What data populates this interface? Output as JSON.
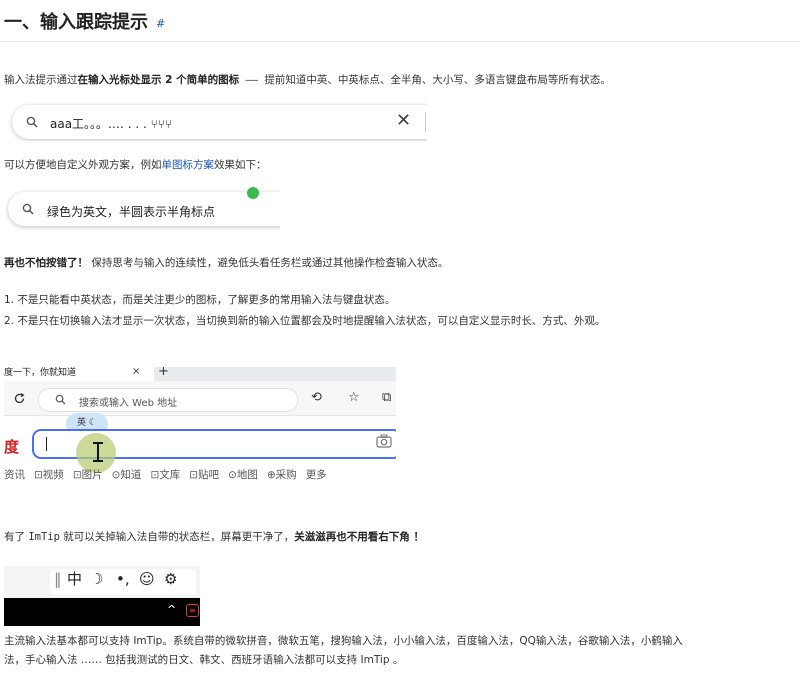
{
  "heading": {
    "title": "一、输入跟踪提示",
    "anchor": "#"
  },
  "intro": {
    "lead": "输入法提示通过",
    "bold": "在输入光标处显示 2 个简单的图标",
    "dash": " —— ",
    "rest": "提前知道中英、中英标点、全半角、大小写、多语言键盘布局等所有状态。"
  },
  "demo1": {
    "text": "aaa工。。。.… . . . ⑂⑂⑂",
    "close_glyph": "✕"
  },
  "custom": {
    "before": "可以方便地自定义外观方案，例如",
    "link": "单图标方案",
    "after": "效果如下："
  },
  "demo2": {
    "text": "绿色为英文，半圆表示半角标点"
  },
  "noerror": {
    "bold": "再也不怕按错了！",
    "rest": " 保持思考与输入的连续性，避免低头看任务栏或通过其他操作检查输入状态。"
  },
  "list": [
    "1. 不是只能看中英状态，而是关注更少的图标，了解更多的常用输入法与键盘状态。",
    "2. 不是只在切换输入法才显示一次状态，当切换到新的输入位置都会及时地提醒输入法状态，可以自定义显示时长、方式、外观。"
  ],
  "browser": {
    "tab_title": "度一下，你就知道",
    "tab_close": "×",
    "tab_new": "+",
    "omnibox_placeholder": "搜索或输入 Web 地址",
    "ime_badge": "英 ☾",
    "logo": "度",
    "categories": [
      "资讯",
      "⊡视频",
      "⊡图片",
      "⊙知道",
      "⊡文库",
      "⊡贴吧",
      "⊙地图",
      "⊕采购",
      "更多"
    ]
  },
  "imtip": {
    "before": "有了 ",
    "name": "ImTip",
    "middle": " 就可以关掉输入法自带的状态栏，屏幕更干净了，",
    "bold": "关滋滋再也不用看右下角 ！"
  },
  "imebar": {
    "items": [
      "‖",
      "中",
      "☽",
      "•,",
      "☺",
      "⚙"
    ],
    "caret": "^",
    "red": "≡"
  },
  "support": {
    "line1": "主流输入法基本都可以支持 ImTip。系统自带的微软拼音，微软五笔，搜狗输入法，小小输入法，百度输入法，QQ输入法，谷歌输入法，小鹤输入",
    "line2": "法，手心输入法 …… 包括我测试的日文、韩文、西班牙语输入法都可以支持 ImTip 。"
  }
}
